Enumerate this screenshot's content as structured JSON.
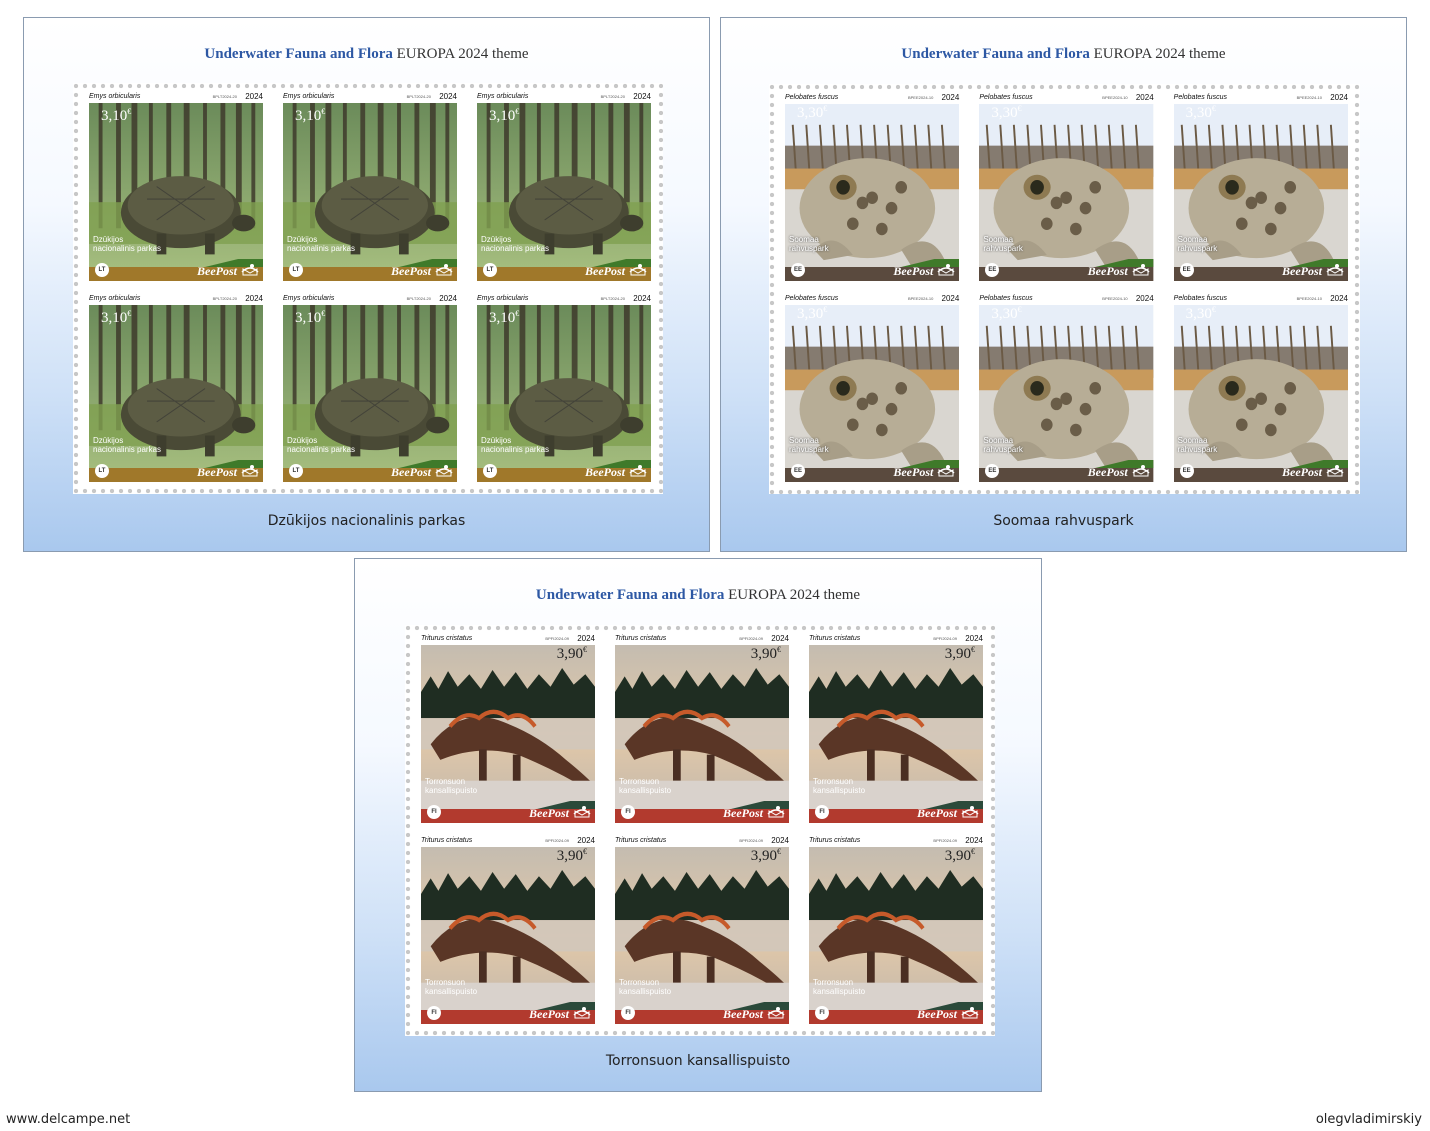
{
  "sheets": [
    {
      "title_colored": "Underwater Fauna and Flora",
      "title_rest": " EUROPA 2024 theme",
      "caption": "Dzūkijos nacionalinis parkas",
      "stamp": {
        "scientific_name": "Emys orbicularis",
        "code": "BPLT2024-20",
        "year": "2024",
        "value": "3,10",
        "currency": "€",
        "park": [
          "Dzūkijos",
          "nacionalinis parkas"
        ],
        "country": "LT",
        "brand": "BeePost",
        "animal": "turtle-illustration",
        "band_color": "#a0782a",
        "accent_color": "#3f7a2a"
      }
    },
    {
      "title_colored": "Underwater Fauna and Flora",
      "title_rest": " EUROPA 2024 theme",
      "caption": "Soomaa rahvuspark",
      "stamp": {
        "scientific_name": "Pelobates fuscus",
        "code": "BPEE2024-10",
        "year": "2024",
        "value": "3,30",
        "currency": "€",
        "park": [
          "Soomaa",
          "rahvuspark"
        ],
        "country": "EE",
        "brand": "BeePost",
        "animal": "toad-illustration",
        "band_color": "#5a4a3e",
        "accent_color": "#3f7a2a"
      }
    },
    {
      "title_colored": "Underwater Fauna and Flora",
      "title_rest": " EUROPA 2024 theme",
      "caption": "Torronsuon kansallispuisto",
      "stamp": {
        "scientific_name": "Triturus cristatus",
        "code": "BPFI2024-09",
        "year": "2024",
        "value": "3,90",
        "currency": "€",
        "park": [
          "Torronsuon",
          "kansallispuisto"
        ],
        "country": "FI",
        "brand": "BeePost",
        "animal": "newt-illustration",
        "band_color": "#b23a2e",
        "accent_color": "#2b4a3a"
      }
    }
  ],
  "footer": {
    "left": "www.delcampe.net",
    "right": "olegvladimirskiy"
  }
}
